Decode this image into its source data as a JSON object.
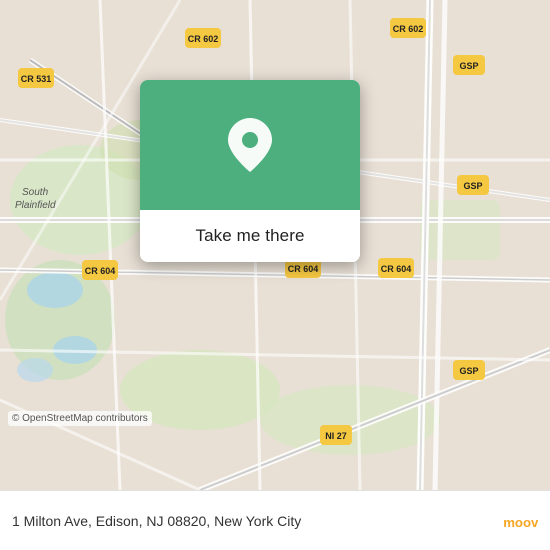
{
  "map": {
    "attribution": "© OpenStreetMap contributors",
    "accent_color": "#4caf7d",
    "popup": {
      "button_label": "Take me there"
    }
  },
  "bottom_bar": {
    "address": "1 Milton Ave, Edison, NJ 08820, New York City"
  },
  "road_labels": {
    "cr531": "CR 531",
    "cr602_left": "CR 602",
    "cr602_right": "CR 602",
    "cr604_left": "CR 604",
    "cr604_mid": "CR 604",
    "cr604_right": "CR 604",
    "gsp_top": "GSP",
    "gsp_mid": "GSP",
    "gsp_bot": "GSP",
    "ni27": "NI 27",
    "south_plainfield": "South\nPlainfield"
  }
}
